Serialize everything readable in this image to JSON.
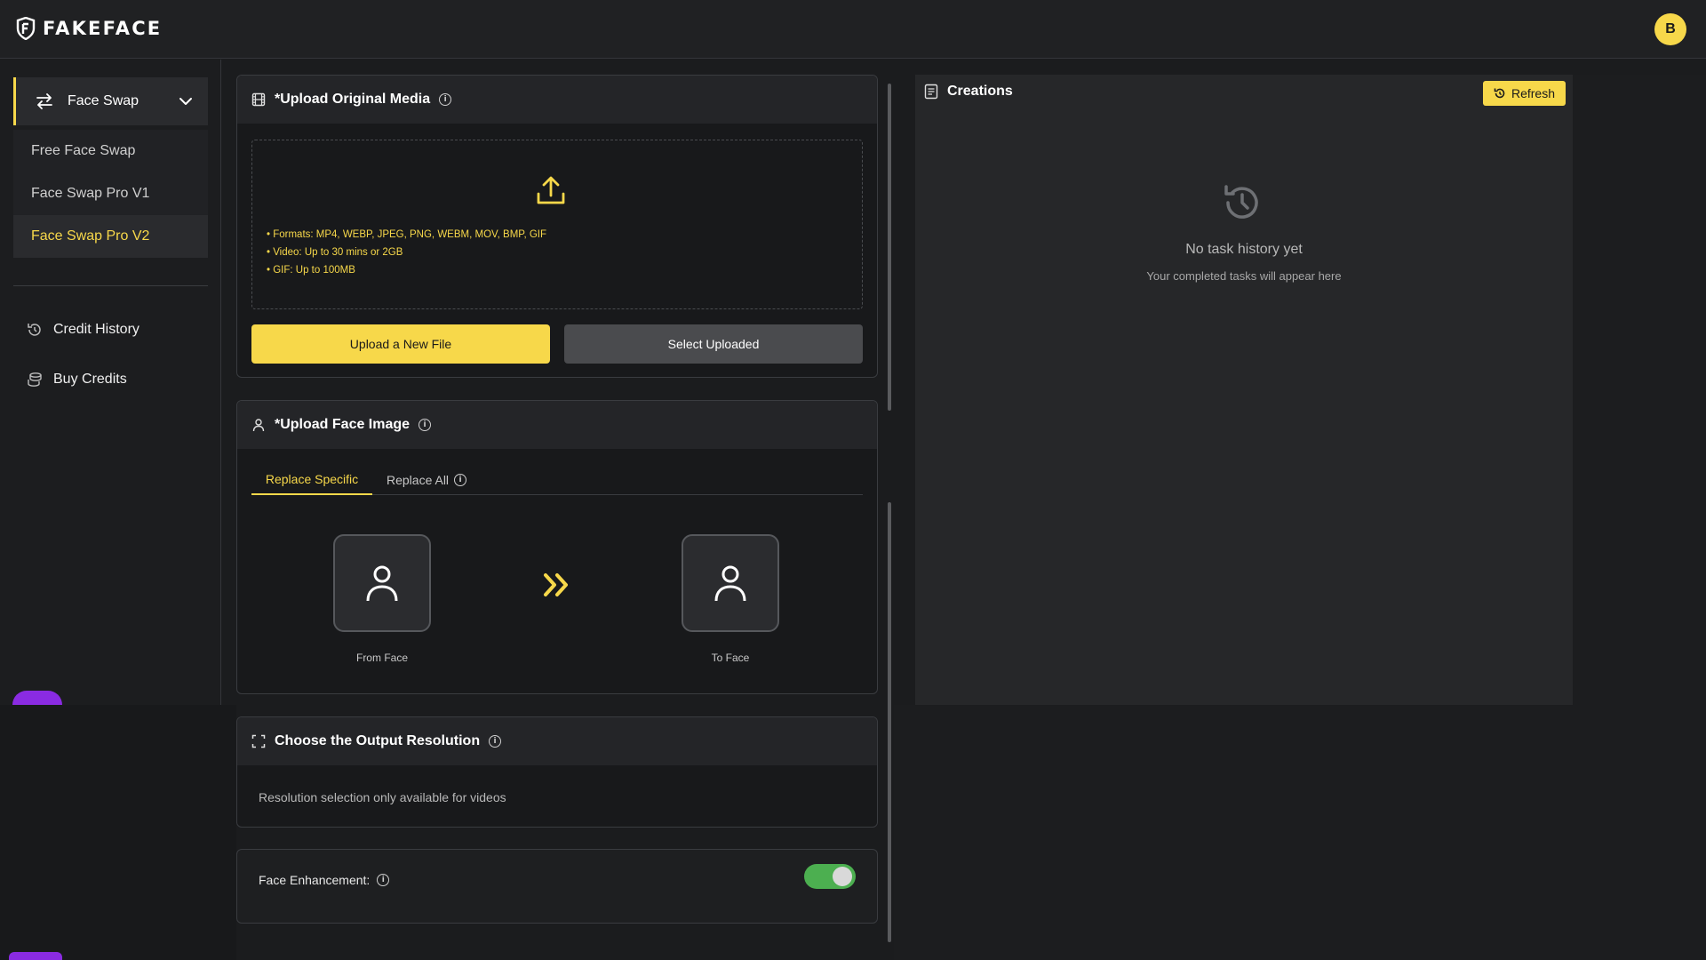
{
  "header": {
    "logo_text": "FAKEFACE",
    "avatar_letter": "B"
  },
  "sidebar": {
    "group_label": "Face Swap",
    "sub_items": [
      {
        "label": "Free Face Swap"
      },
      {
        "label": "Face Swap Pro V1"
      },
      {
        "label": "Face Swap Pro V2"
      }
    ],
    "links": [
      {
        "label": "Credit History",
        "icon": "history-icon"
      },
      {
        "label": "Buy Credits",
        "icon": "coins-icon"
      }
    ]
  },
  "upload_media": {
    "title": "*Upload Original Media",
    "formats_line": "• Formats: MP4, WEBP, JPEG, PNG, WEBM, MOV, BMP, GIF",
    "video_line": "• Video: Up to 30 mins or 2GB",
    "gif_line": "• GIF: Up to 100MB",
    "upload_button": "Upload a New File",
    "select_button": "Select Uploaded"
  },
  "upload_face": {
    "title": "*Upload Face Image",
    "tab_specific": "Replace Specific",
    "tab_all": "Replace All",
    "from_label": "From Face",
    "to_label": "To Face"
  },
  "resolution": {
    "title": "Choose the Output Resolution",
    "note": "Resolution selection only available for videos"
  },
  "enhancement": {
    "label": "Face Enhancement:",
    "enabled": true
  },
  "creations": {
    "title": "Creations",
    "refresh_label": "Refresh",
    "empty_title": "No task history yet",
    "empty_subtitle": "Your completed tasks will appear here"
  },
  "colors": {
    "accent": "#f7d84a",
    "toggle_on": "#4caf50",
    "promo_purple": "#8a2be2"
  }
}
